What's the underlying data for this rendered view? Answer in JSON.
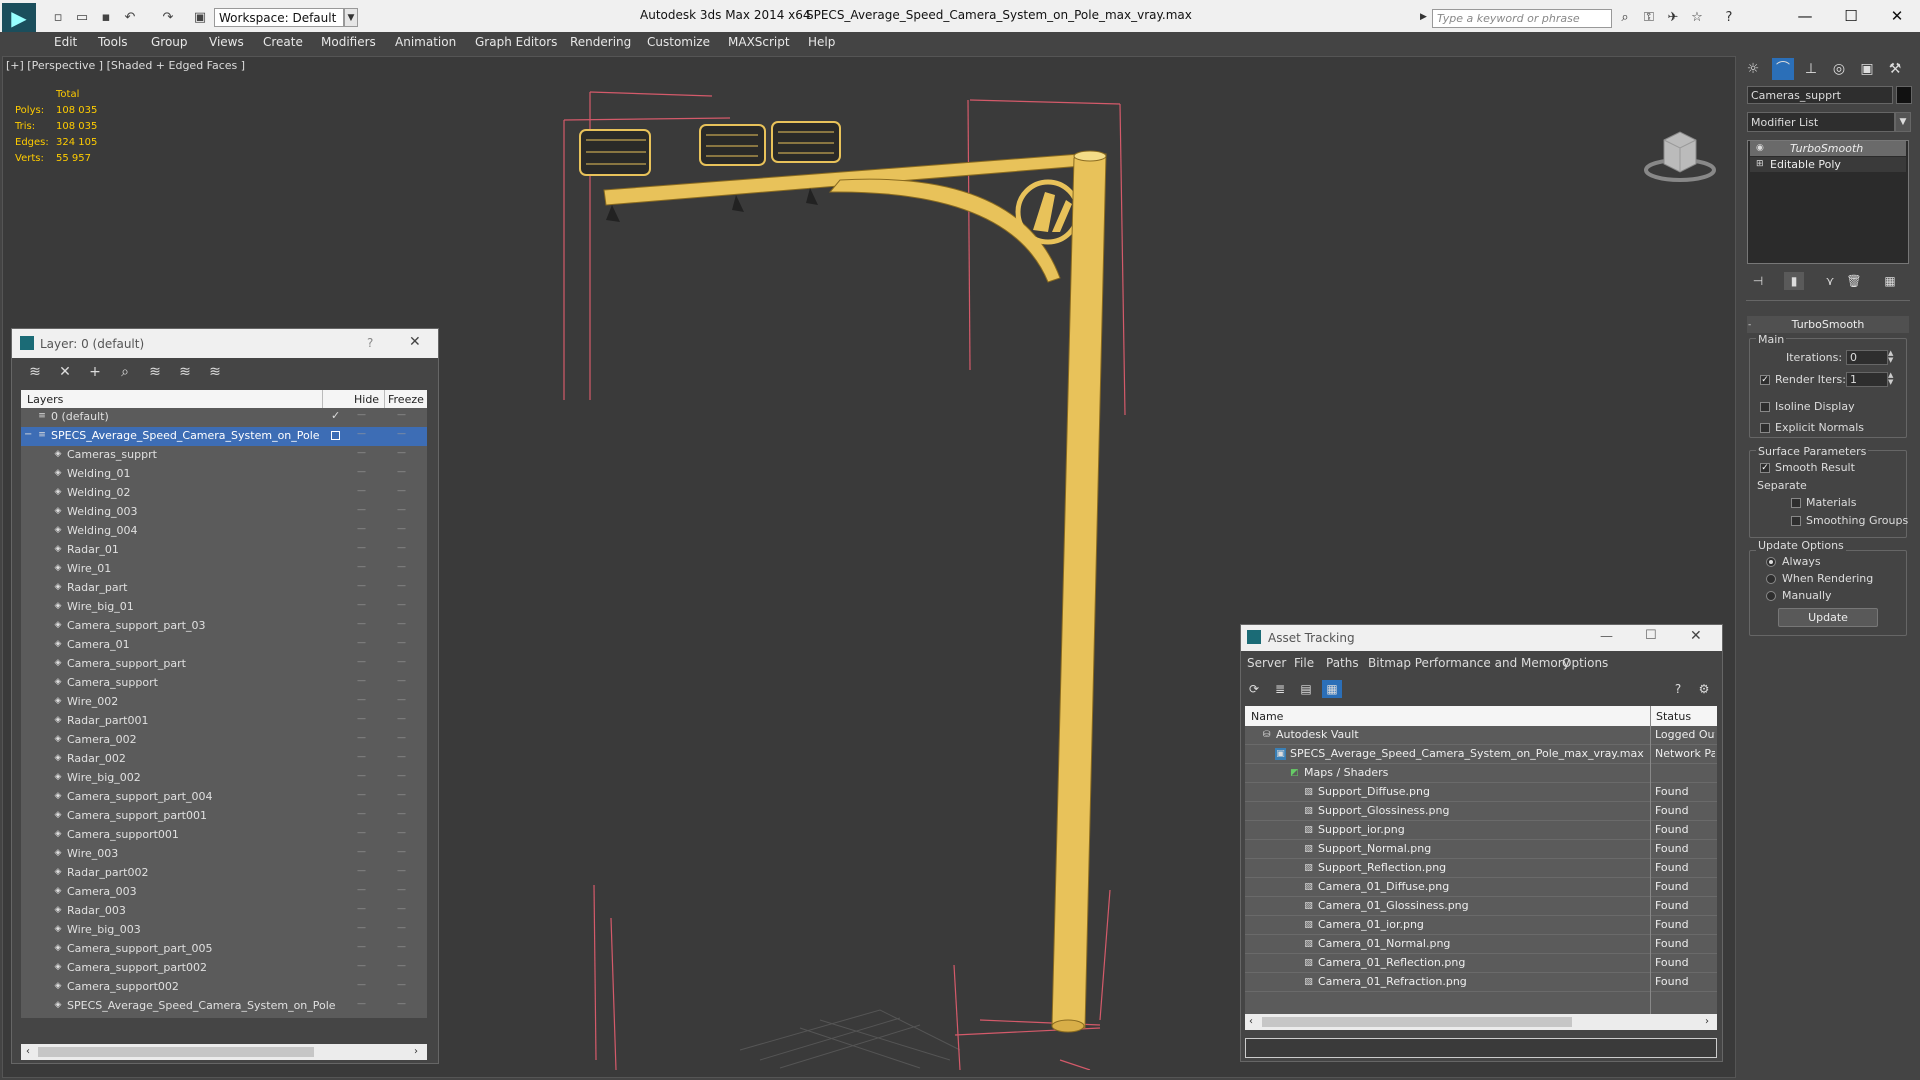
{
  "titlebar": {
    "workspace": "Workspace: Default",
    "app": "Autodesk 3ds Max  2014 x64",
    "file": "SPECS_Average_Speed_Camera_System_on_Pole_max_vray.max",
    "search_placeholder": "Type a keyword or phrase"
  },
  "menu": [
    "Edit",
    "Tools",
    "Group",
    "Views",
    "Create",
    "Modifiers",
    "Animation",
    "Graph Editors",
    "Rendering",
    "Customize",
    "MAXScript",
    "Help"
  ],
  "viewport": {
    "label": "[+] [Perspective ] [Shaded + Edged Faces ]",
    "stats_header": "Total",
    "stats": [
      {
        "label": "Polys:",
        "value": "108 035"
      },
      {
        "label": "Tris:",
        "value": "108 035"
      },
      {
        "label": "Edges:",
        "value": "324 105"
      },
      {
        "label": "Verts:",
        "value": "55 957"
      }
    ]
  },
  "command_panel": {
    "object_name": "Cameras_supprt",
    "modifier_list": "Modifier List",
    "stack": [
      "TurboSmooth",
      "Editable Poly"
    ],
    "rollout_title": "TurboSmooth",
    "main_label": "Main",
    "iterations_label": "Iterations:",
    "iterations_value": "0",
    "render_iters_label": "Render Iters:",
    "render_iters_value": "1",
    "isoline_label": "Isoline Display",
    "explicit_normals_label": "Explicit Normals",
    "surface_params_label": "Surface Parameters",
    "smooth_result_label": "Smooth Result",
    "separate_label": "Separate",
    "materials_label": "Materials",
    "smoothing_groups_label": "Smoothing Groups",
    "update_options_label": "Update Options",
    "always_label": "Always",
    "when_rendering_label": "When Rendering",
    "manually_label": "Manually",
    "update_button": "Update"
  },
  "layer_window": {
    "title": "Layer: 0 (default)",
    "help": "?",
    "col_layers": "Layers",
    "col_hide": "Hide",
    "col_freeze": "Freeze",
    "rows": [
      {
        "name": "0 (default)",
        "level": 1
      },
      {
        "name": "SPECS_Average_Speed_Camera_System_on_Pole",
        "level": 1
      },
      {
        "name": "Cameras_supprt",
        "level": 2
      },
      {
        "name": "Welding_01",
        "level": 2
      },
      {
        "name": "Welding_02",
        "level": 2
      },
      {
        "name": "Welding_003",
        "level": 2
      },
      {
        "name": "Welding_004",
        "level": 2
      },
      {
        "name": "Radar_01",
        "level": 2
      },
      {
        "name": "Wire_01",
        "level": 2
      },
      {
        "name": "Radar_part",
        "level": 2
      },
      {
        "name": "Wire_big_01",
        "level": 2
      },
      {
        "name": "Camera_support_part_03",
        "level": 2
      },
      {
        "name": "Camera_01",
        "level": 2
      },
      {
        "name": "Camera_support_part",
        "level": 2
      },
      {
        "name": "Camera_support",
        "level": 2
      },
      {
        "name": "Wire_002",
        "level": 2
      },
      {
        "name": "Radar_part001",
        "level": 2
      },
      {
        "name": "Camera_002",
        "level": 2
      },
      {
        "name": "Radar_002",
        "level": 2
      },
      {
        "name": "Wire_big_002",
        "level": 2
      },
      {
        "name": "Camera_support_part_004",
        "level": 2
      },
      {
        "name": "Camera_support_part001",
        "level": 2
      },
      {
        "name": "Camera_support001",
        "level": 2
      },
      {
        "name": "Wire_003",
        "level": 2
      },
      {
        "name": "Radar_part002",
        "level": 2
      },
      {
        "name": "Camera_003",
        "level": 2
      },
      {
        "name": "Radar_003",
        "level": 2
      },
      {
        "name": "Wire_big_003",
        "level": 2
      },
      {
        "name": "Camera_support_part_005",
        "level": 2
      },
      {
        "name": "Camera_support_part002",
        "level": 2
      },
      {
        "name": "Camera_support002",
        "level": 2
      },
      {
        "name": "SPECS_Average_Speed_Camera_System_on_Pole",
        "level": 2
      }
    ]
  },
  "asset_tracking": {
    "title": "Asset Tracking",
    "menu": [
      "Server",
      "File",
      "Paths",
      "Bitmap Performance and Memory",
      "Options"
    ],
    "col_name": "Name",
    "col_status": "Status",
    "rows": [
      {
        "name": "Autodesk Vault",
        "status": "Logged Out",
        "level": 1
      },
      {
        "name": "SPECS_Average_Speed_Camera_System_on_Pole_max_vray.max",
        "status": "Network Pa",
        "level": 2
      },
      {
        "name": "Maps / Shaders",
        "status": "",
        "level": 3
      },
      {
        "name": "Support_Diffuse.png",
        "status": "Found",
        "level": 4
      },
      {
        "name": "Support_Glossiness.png",
        "status": "Found",
        "level": 4
      },
      {
        "name": "Support_ior.png",
        "status": "Found",
        "level": 4
      },
      {
        "name": "Support_Normal.png",
        "status": "Found",
        "level": 4
      },
      {
        "name": "Support_Reflection.png",
        "status": "Found",
        "level": 4
      },
      {
        "name": "Camera_01_Diffuse.png",
        "status": "Found",
        "level": 4
      },
      {
        "name": "Camera_01_Glossiness.png",
        "status": "Found",
        "level": 4
      },
      {
        "name": "Camera_01_ior.png",
        "status": "Found",
        "level": 4
      },
      {
        "name": "Camera_01_Normal.png",
        "status": "Found",
        "level": 4
      },
      {
        "name": "Camera_01_Reflection.png",
        "status": "Found",
        "level": 4
      },
      {
        "name": "Camera_01_Refraction.png",
        "status": "Found",
        "level": 4
      }
    ]
  },
  "colors": {
    "pole": "#e8c25a",
    "selection": "#3d6db5",
    "stats": "#ffcc00"
  }
}
